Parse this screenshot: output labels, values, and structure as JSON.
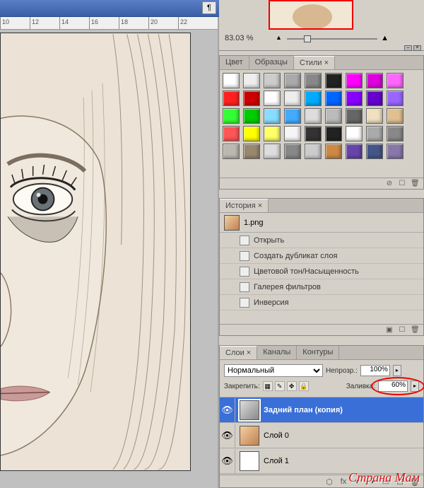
{
  "toolbar": {
    "paragraph_mark": "¶"
  },
  "ruler": {
    "marks": [
      "10",
      "12",
      "14",
      "16",
      "18",
      "20",
      "22"
    ]
  },
  "navigator": {
    "zoom": "83.03 %"
  },
  "styles_panel": {
    "tabs": {
      "color": "Цвет",
      "swatches": "Образцы",
      "styles": "Стили"
    },
    "active_tab": "styles",
    "swatches": [
      "#ffffff",
      "#eeeeee",
      "#cccccc",
      "#aaaaaa",
      "#888888",
      "#222222",
      "#ff00ff",
      "#dd00dd",
      "#ff66ff",
      "#ff2020",
      "#cc0000",
      "#ffffff",
      "#eeeeee",
      "#00aaff",
      "#0066ff",
      "#8800ff",
      "#6600cc",
      "#9966ff",
      "#33ff33",
      "#00cc00",
      "#88ddff",
      "#44aaff",
      "#dddddd",
      "#bbbbbb",
      "#666666",
      "#f0e0c0",
      "#e0c090",
      "#ff5555",
      "#ffff00",
      "#ffff66",
      "#f5f5f5",
      "#333333",
      "#222222",
      "#ffffff",
      "#aaaaaa",
      "#888888",
      "#bbb8b0",
      "#998870",
      "#dddddd",
      "#888888",
      "#cccccc",
      "#cc8844",
      "#6644aa",
      "#445588",
      "#8877aa"
    ],
    "footer_icons": [
      "⊘",
      "☐",
      "🗑"
    ]
  },
  "history_panel": {
    "tab": "История",
    "file": "1.png",
    "items": [
      "Открыть",
      "Создать дубликат слоя",
      "Цветовой тон/Насыщенность",
      "Галерея фильтров",
      "Инверсия"
    ]
  },
  "layers_panel": {
    "tabs": {
      "layers": "Слои",
      "channels": "Каналы",
      "paths": "Контуры"
    },
    "active_tab": "layers",
    "blend_mode": "Нормальный",
    "opacity_label": "Непрозр.:",
    "opacity_value": "100%",
    "lock_label": "Закрепить:",
    "fill_label": "Заливка:",
    "fill_value": "60%",
    "layers": [
      {
        "name": "Задний план (копия)",
        "selected": true
      },
      {
        "name": "Слой 0",
        "selected": false
      },
      {
        "name": "Слой 1",
        "selected": false
      }
    ],
    "footer_icons": [
      "⬢",
      "fx",
      "◐",
      "□",
      "📁",
      "☐",
      "🗑"
    ]
  },
  "watermark": "Страна Мам"
}
